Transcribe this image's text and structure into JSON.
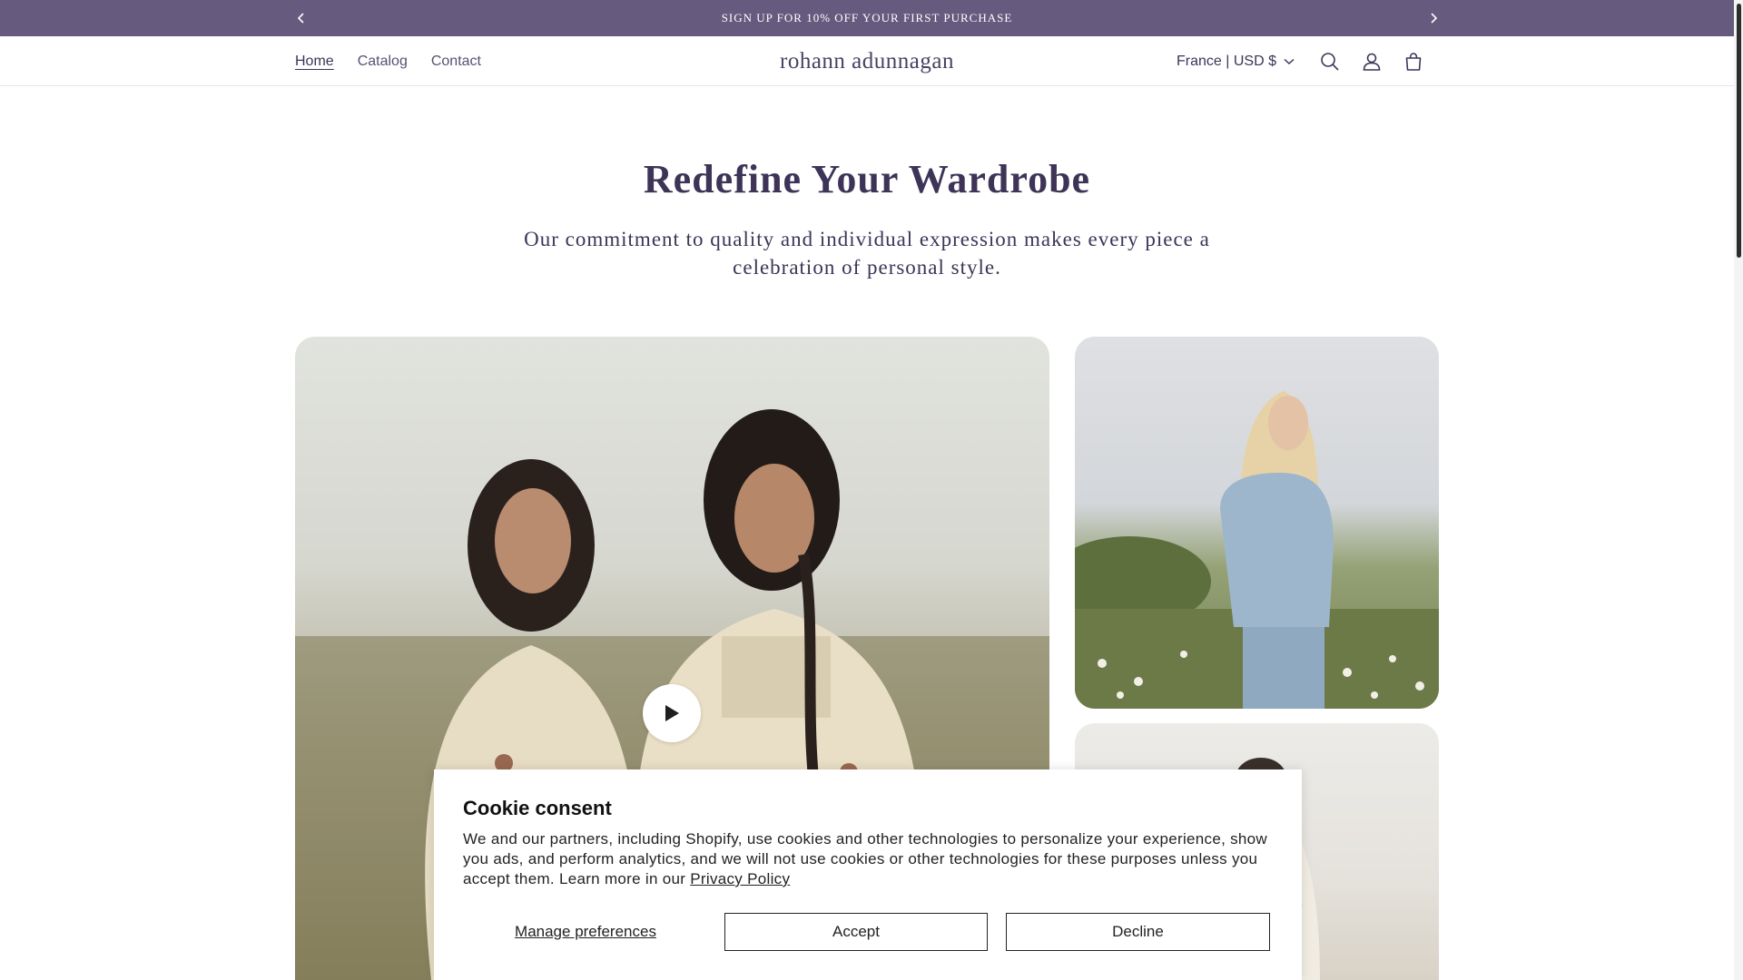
{
  "announcement": {
    "text": "SIGN UP FOR 10% OFF YOUR FIRST PURCHASE",
    "prev_icon": "chevron-left-icon",
    "next_icon": "chevron-right-icon",
    "background": "#665a7e"
  },
  "header": {
    "logo": "rohann adunnagan",
    "nav": [
      {
        "label": "Home",
        "active": true
      },
      {
        "label": "Catalog",
        "active": false
      },
      {
        "label": "Contact",
        "active": false
      }
    ],
    "locale": "France | USD $",
    "icons": [
      "search-icon",
      "account-icon",
      "cart-icon"
    ]
  },
  "hero": {
    "title": "Redefine Your Wardrobe",
    "subtitle": "Our commitment to quality and individual expression makes every piece a celebration of personal style."
  },
  "media": {
    "main_video_icon": "play-icon",
    "images": [
      "two-women-in-field-video",
      "woman-in-denim-jacket-image",
      "woman-in-white-dress-image"
    ]
  },
  "cookie": {
    "title": "Cookie consent",
    "body": "We and our partners, including Shopify, use cookies and other technologies to personalize your experience, show you ads, and perform analytics, and we will not use cookies or other technologies for these purposes unless you accept them. Learn more in our ",
    "privacy_link": "Privacy Policy",
    "manage_label": "Manage preferences",
    "accept_label": "Accept",
    "decline_label": "Decline"
  },
  "colors": {
    "accent": "#665a7e",
    "text": "#3d3458"
  }
}
